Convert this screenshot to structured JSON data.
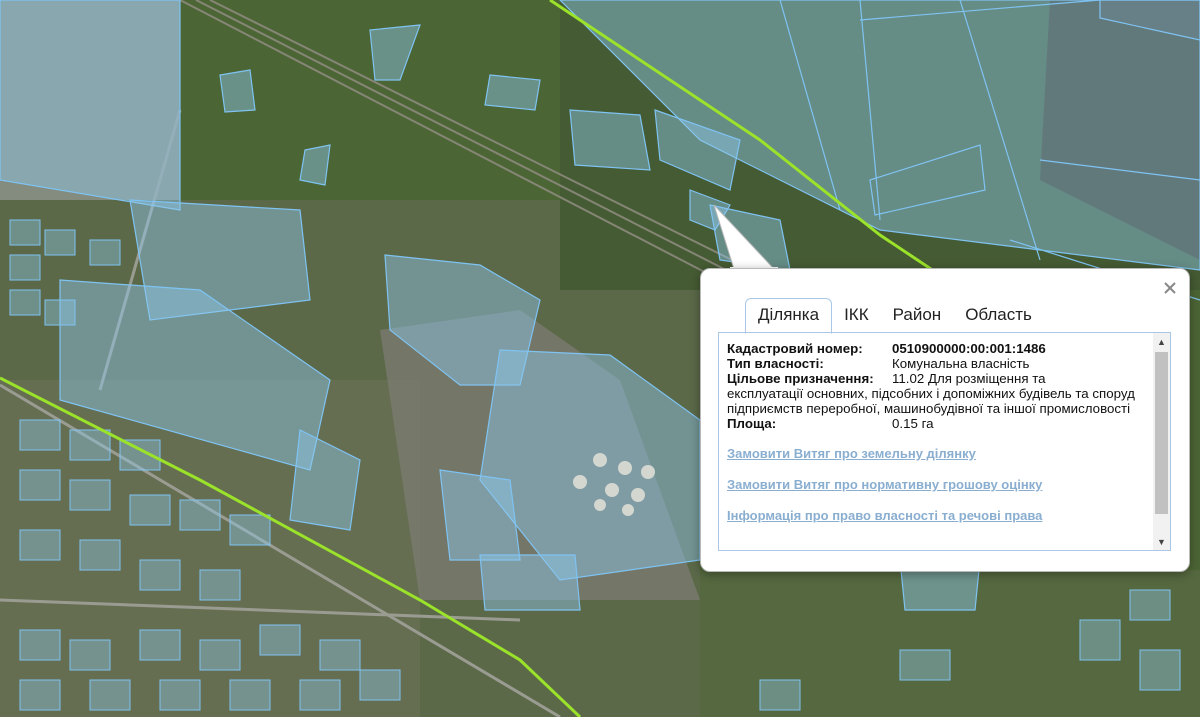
{
  "popup": {
    "tabs": [
      {
        "label": "Ділянка",
        "active": true
      },
      {
        "label": "ІКК",
        "active": false
      },
      {
        "label": "Район",
        "active": false
      },
      {
        "label": "Область",
        "active": false
      }
    ],
    "fields": {
      "cadastral_label": "Кадастровий номер:",
      "cadastral_value": "0510900000:00:001:1486",
      "ownership_label": "Тип власності:",
      "ownership_value": "Комунальна власність",
      "purpose_label": "Цільове призначення:",
      "purpose_value_first": "11.02 Для розміщення та",
      "purpose_value_rest": "експлуатації основних, підсобних і допоміжних будівель та споруд підприємств переробної, машинобудівної та іншої промисловості",
      "area_label": "Площа:",
      "area_value": "0.15 га"
    },
    "links": [
      "Замовити Витяг про земельну ділянку",
      "Замовити Витяг про нормативну грошову оцінку",
      "Інформація про право власності та речові права"
    ],
    "scroll": {
      "position": 0.0
    }
  },
  "map": {
    "colors": {
      "parcel_fill": "#8fc8ec",
      "parcel_stroke": "#7fc3f2",
      "boundary": "#9be22a",
      "field_bg": "#56663a",
      "urban": "#6f7666"
    }
  }
}
